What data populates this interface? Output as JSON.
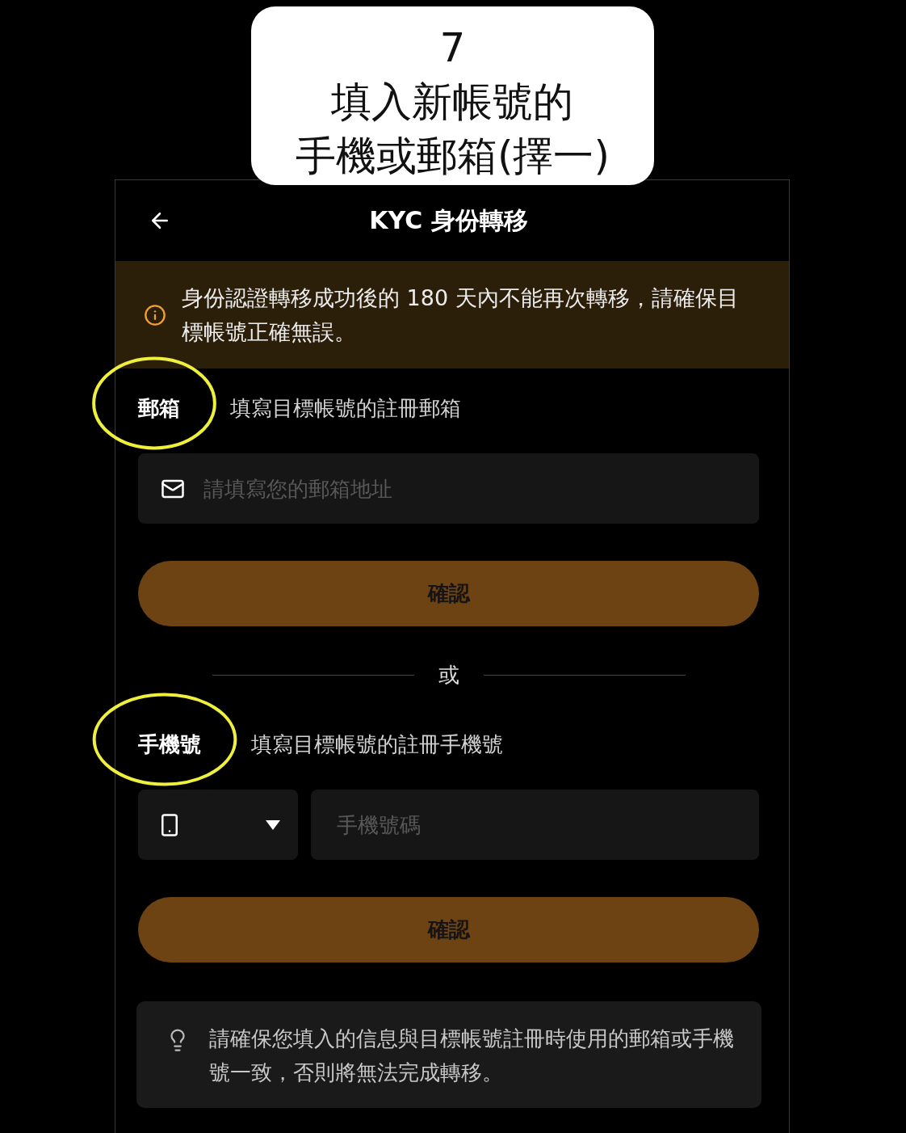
{
  "callout": {
    "step": "7",
    "lines": [
      "填入新帳號的",
      "手機或郵箱(擇一)"
    ]
  },
  "header": {
    "title": "KYC 身份轉移"
  },
  "notice": {
    "text": "身份認證轉移成功後的 180 天內不能再次轉移，請確保目標帳號正確無誤。"
  },
  "forms": [
    {
      "kind": "email",
      "label": "郵箱",
      "hint": "填寫目標帳號的註冊郵箱",
      "highlighted": true,
      "field": {
        "placeholder": "請填寫您的郵箱地址"
      },
      "button": "確認"
    },
    {
      "kind": "divider",
      "label": "或"
    },
    {
      "kind": "phone",
      "label": "手機號",
      "hint": "填寫目標帳號的註冊手機號",
      "highlighted": true,
      "field": {
        "placeholder": "手機號碼"
      },
      "button": "確認"
    }
  ],
  "tip": {
    "text": "請確保您填入的信息與目標帳號註冊時使用的郵箱或手機號一致，否則將無法完成轉移。"
  }
}
